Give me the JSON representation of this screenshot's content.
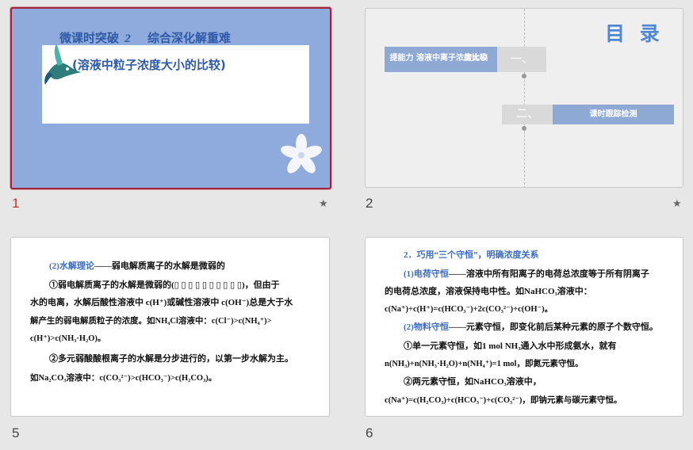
{
  "thumbnails": [
    {
      "number": "1",
      "selected": true
    },
    {
      "number": "2",
      "selected": false
    },
    {
      "number": "5",
      "selected": false
    },
    {
      "number": "6",
      "selected": false
    }
  ],
  "star_glyph": "★",
  "slide1": {
    "title_prefix": "微课时突破",
    "title_num": "2",
    "title_main": "综合深化解重难",
    "subtitle": "(溶液中粒子浓度大小的比较)"
  },
  "slide2": {
    "heading": "目 录",
    "item1_label": "提能力  溶液中离子浓度大小\n的比较",
    "item1_line1": "提能力  溶液中离子浓度大小",
    "item1_line2": "的比较",
    "item1_num": "一、",
    "item2_num": "二、",
    "item2_label": "课时跟踪检测"
  },
  "slide5": {
    "l1_a": "(2)水解理论",
    "l1_b": "——弱电解质离子的水解是微弱的",
    "l2": "①弱电解质离子的水解是微弱的(▯ ▯ ▯ ▯ ▯ ▯ ▯ ▯ ▯ ▯)，但由于",
    "l3": "水的电离，水解后酸性溶液中 c(H⁺)或碱性溶液中 c(OH⁻)总是大于水",
    "l4": "解产生的弱电解质粒子的浓度。如NH₄Cl溶液中：c(Cl⁻)>c(NH₄⁺)>",
    "l5": "c(H⁺)>c(NH₃·H₂O)。",
    "l6": "②多元弱酸酸根离子的水解是分步进行的，以第一步水解为主。",
    "l7": "如Na₂CO₃溶液中：c(CO₃²⁻)>c(HCO₃⁻)>c(H₂CO₃)。"
  },
  "slide6": {
    "l1": "2．巧用“三个守恒”，明确浓度关系",
    "l2_a": "(1)电荷守恒",
    "l2_b": "——溶液中所有阳离子的电荷总浓度等于所有阴离子",
    "l3": "的电荷总浓度，溶液保持电中性。如NaHCO₃溶液中：",
    "l4": "c(Na⁺)+c(H⁺)=c(HCO₃⁻)+2c(CO₃²⁻)+c(OH⁻)。",
    "l5_a": "(2)物料守恒",
    "l5_b": "——元素守恒，即变化前后某种元素的原子个数守恒。",
    "l6": "①单一元素守恒，如1 mol NH₃通入水中形成氨水，就有",
    "l7": "n(NH₃)+n(NH₃·H₂O)+n(NH₄⁺)=1 mol，即氮元素守恒。",
    "l8": "②两元素守恒，如NaHCO₃溶液中，",
    "l9": "c(Na⁺)=c(H₂CO₃)+c(HCO₃⁻)+c(CO₃²⁻)，即钠元素与碳元素守恒。"
  }
}
